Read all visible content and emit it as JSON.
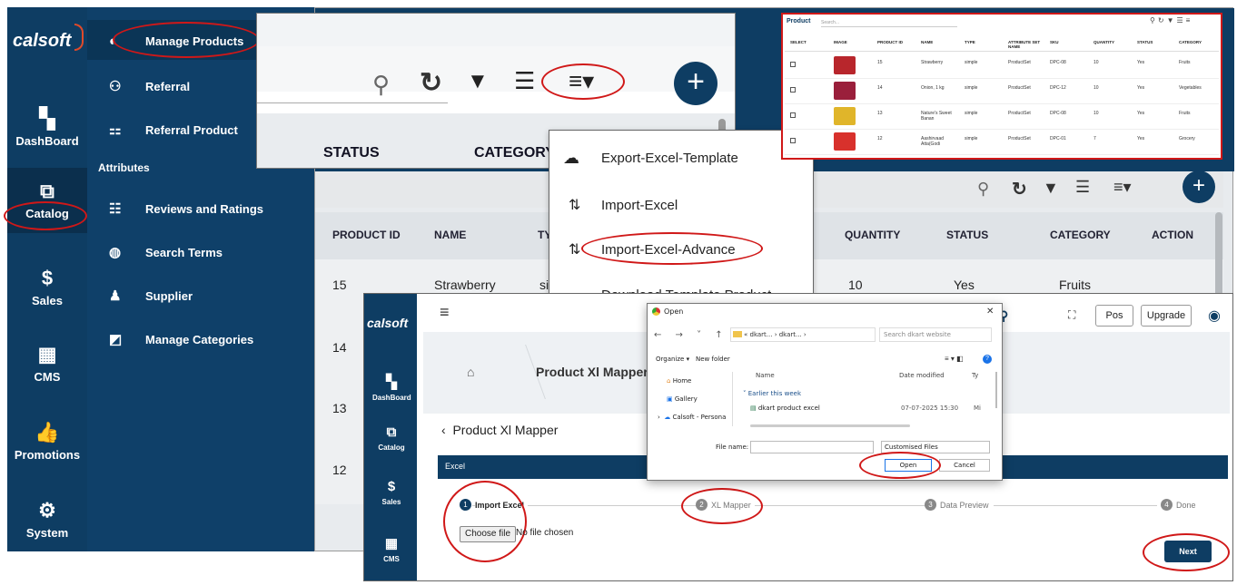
{
  "brand": "calsoft",
  "sidebar": [
    {
      "label": "DashBoard",
      "icon": "dashboard-icon"
    },
    {
      "label": "Catalog",
      "icon": "catalog-icon"
    },
    {
      "label": "Sales",
      "icon": "dollar-icon"
    },
    {
      "label": "CMS",
      "icon": "cms-icon"
    },
    {
      "label": "Promotions",
      "icon": "thumbs-up-icon"
    },
    {
      "label": "System",
      "icon": "gear-icon"
    }
  ],
  "catalog_menu": {
    "items": [
      "Manage Products",
      "Referral",
      "Referral Product"
    ],
    "section": "Attributes",
    "attr_items": [
      "Reviews and Ratings",
      "Search Terms",
      "Supplier",
      "Manage Categories"
    ]
  },
  "zoom_toolbar": {
    "headers": [
      "STATUS",
      "CATEGORY"
    ]
  },
  "dropdown": [
    "Export-Excel-Template",
    "Import-Excel",
    "Import-Excel-Advance",
    "Download Template Product"
  ],
  "main_table": {
    "headers": [
      "PRODUCT ID",
      "NAME",
      "TY",
      "QUANTITY",
      "STATUS",
      "CATEGORY",
      "ACTION"
    ],
    "rows": [
      {
        "id": "15",
        "name": "Strawberry",
        "type": "si",
        "qty": "10",
        "status": "Yes",
        "category": "Fruits"
      },
      {
        "id": "14"
      },
      {
        "id": "13"
      },
      {
        "id": "12"
      }
    ]
  },
  "product_card": {
    "title": "Product",
    "search_placeholder": "Search...",
    "headers": [
      "SELECT",
      "IMAGE",
      "PRODUCT ID",
      "NAME",
      "TYPE",
      "ATTRIBUTE SET NAME",
      "SKU",
      "QUANTITY",
      "STATUS",
      "CATEGORY"
    ],
    "rows": [
      {
        "id": "15",
        "name": "Strawberry",
        "type": "simple",
        "attr": "ProductSet",
        "sku": "DPC-08",
        "qty": "10",
        "status": "Yes",
        "cat": "Fruits",
        "img": "#b8262c"
      },
      {
        "id": "14",
        "name": "Onion, 1 kg",
        "type": "simple",
        "attr": "ProductSet",
        "sku": "DPC-12",
        "qty": "10",
        "status": "Yes",
        "cat": "Vegetables",
        "img": "#9a1f3b"
      },
      {
        "id": "13",
        "name": "Nature's Sweet Banan",
        "type": "simple",
        "attr": "ProductSet",
        "sku": "DPC-08",
        "qty": "10",
        "status": "Yes",
        "cat": "Fruits",
        "img": "#e0b52a"
      },
      {
        "id": "12",
        "name": "Aashirvaad Atta(Godi",
        "type": "simple",
        "attr": "ProductSet",
        "sku": "DPC-01",
        "qty": "7",
        "status": "Yes",
        "cat": "Grocery",
        "img": "#d8312c"
      }
    ]
  },
  "mapper": {
    "sidebar": [
      "DashBoard",
      "Catalog",
      "Sales",
      "CMS"
    ],
    "topbar": {
      "pos": "Pos",
      "upgrade": "Upgrade"
    },
    "breadcrumb": "Product Xl Mapper",
    "back_title": "Product Xl Mapper",
    "section": "Excel",
    "steps": [
      {
        "num": "1",
        "label": "Import Excel"
      },
      {
        "num": "2",
        "label": "XL Mapper"
      },
      {
        "num": "3",
        "label": "Data Preview"
      },
      {
        "num": "4",
        "label": "Done"
      }
    ],
    "choose_file": "Choose file",
    "no_file": "No file chosen",
    "next": "Next"
  },
  "open_dialog": {
    "title": "Open",
    "path": "« dkart... › dkart... ›",
    "search_placeholder": "Search dkart website",
    "organize": "Organize ▾",
    "new_folder": "New folder",
    "nav": [
      "Home",
      "Gallery",
      "Calsoft - Persona"
    ],
    "col_name": "Name",
    "col_date": "Date modified",
    "col_type": "Ty",
    "group": "Earlier this week",
    "file_name": "dkart product excel",
    "file_date": "07-07-2025 15:30",
    "file_type": "Mi",
    "file_name_label": "File name:",
    "filter": "Customised Files",
    "open_btn": "Open",
    "cancel_btn": "Cancel"
  }
}
